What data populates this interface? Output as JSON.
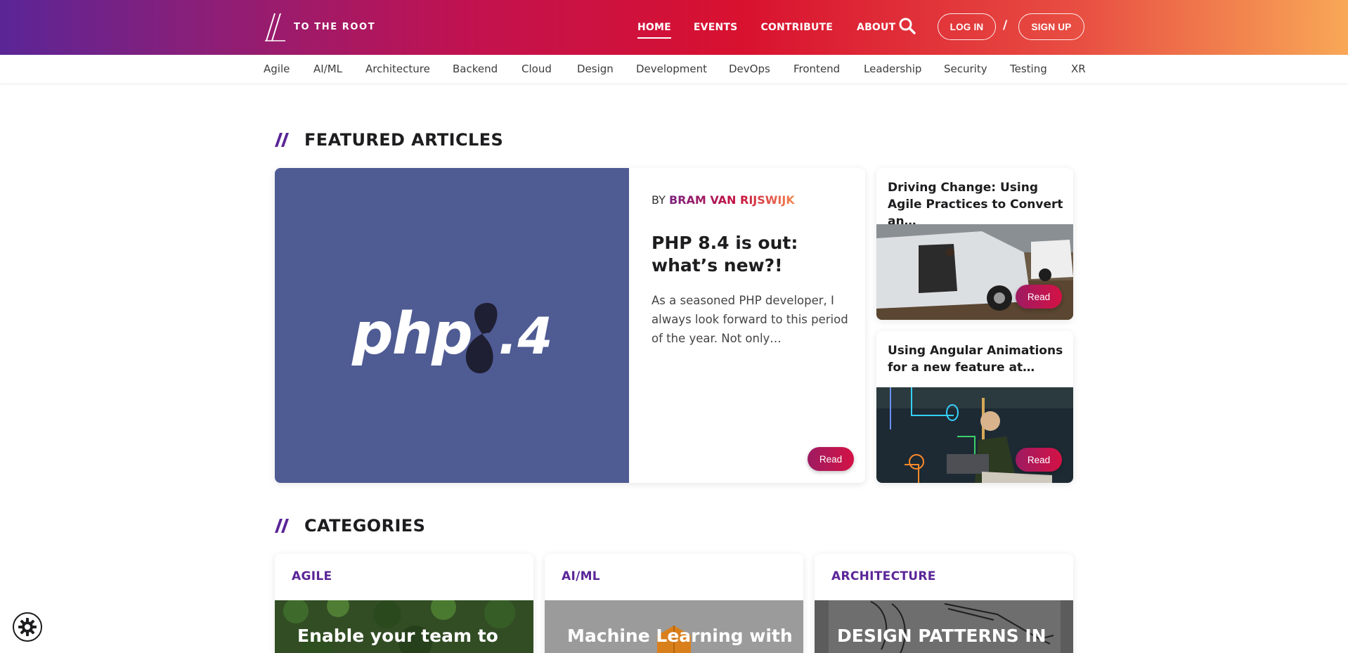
{
  "header": {
    "logo_text": "TO THE ROOT",
    "nav": [
      {
        "label": "HOME",
        "active": true
      },
      {
        "label": "EVENTS",
        "active": false
      },
      {
        "label": "CONTRIBUTE",
        "active": false
      },
      {
        "label": "ABOUT",
        "active": false
      }
    ],
    "search_icon": "search-icon",
    "login_label": "LOG IN",
    "separator": "/",
    "signup_label": "SIGN UP",
    "gradient": [
      "#5a2597",
      "#c2124f",
      "#d8112f",
      "#f8a857"
    ]
  },
  "categories_bar": [
    "Agile",
    "AI/ML",
    "Architecture",
    "Backend",
    "Cloud",
    "Design",
    "Development",
    "DevOps",
    "Frontend",
    "Leadership",
    "Security",
    "Testing",
    "XR"
  ],
  "featured": {
    "heading": "FEATURED ARTICLES",
    "main": {
      "image_text": "php8.4",
      "by_prefix": "BY",
      "author": "BRAM VAN RIJSWIJK",
      "title": "PHP 8.4 is out: what’s new?!",
      "excerpt": "As a seasoned PHP developer, I always look forward to this period of the year. Not only…",
      "read_label": "Read"
    },
    "side": [
      {
        "title": "Driving Change: Using Agile Practices to Convert an…",
        "read_label": "Read"
      },
      {
        "title": "Using Angular Animations for a new feature at…",
        "read_label": "Read"
      }
    ]
  },
  "categories": {
    "heading": "CATEGORIES",
    "cards": [
      {
        "label": "AGILE",
        "image_text": "Enable your team to"
      },
      {
        "label": "AI/ML",
        "image_text": "Machine Learning with"
      },
      {
        "label": "ARCHITECTURE",
        "image_text": "DESIGN PATTERNS IN"
      }
    ]
  },
  "cookie_settings_icon": "gear-icon",
  "colors": {
    "accent_purple": "#5a2597",
    "accent_red": "#d41245",
    "php_bg": "#4f5b93"
  }
}
